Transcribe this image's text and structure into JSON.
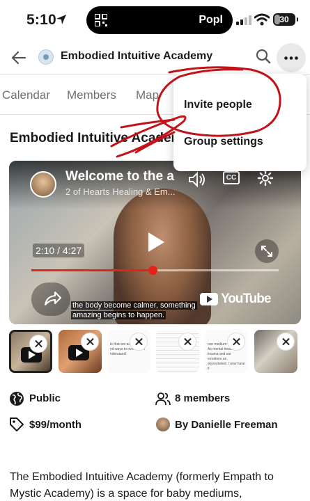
{
  "status_bar": {
    "time": "5:10",
    "island_app": "Popl",
    "battery": "30"
  },
  "header": {
    "group_name": "Embodied Intuitive Academy"
  },
  "tabs": [
    "Calendar",
    "Members",
    "Map"
  ],
  "menu": {
    "invite": "Invite people",
    "settings": "Group settings"
  },
  "page_title": "Embodied Intuitive Academy",
  "video": {
    "title": "Welcome to the a",
    "channel": "2 of Hearts Healing & Em...",
    "cc": "CC",
    "elapsed": "2:10",
    "separator": " / ",
    "duration": "4:27",
    "progress": 0.49,
    "caption_line1": "the body become calmer, something",
    "caption_line2": "amazing begins to happen.",
    "brand": "YouTube"
  },
  "thumbnails": [
    {
      "kind": "video",
      "selected": true
    },
    {
      "kind": "video",
      "selected": false
    },
    {
      "kind": "text",
      "text": "ts that are achievable f nd ways to overcome t nderstand!"
    },
    {
      "kind": "text",
      "text": ""
    },
    {
      "kind": "text",
      "text": "ose medium co energy. As mental health th ft trauma and our emotions ue skyrocketed. I now have fi"
    },
    {
      "kind": "photo",
      "selected": false
    }
  ],
  "meta": {
    "privacy": "Public",
    "members": "8 members",
    "price": "$99/month",
    "host": "By Danielle Freeman"
  },
  "description": "The Embodied Intuitive Academy (formerly Empath to Mystic Academy) is a space for baby mediums,",
  "colors": {
    "annotation": "#c0141b",
    "progress": "#e62117"
  }
}
